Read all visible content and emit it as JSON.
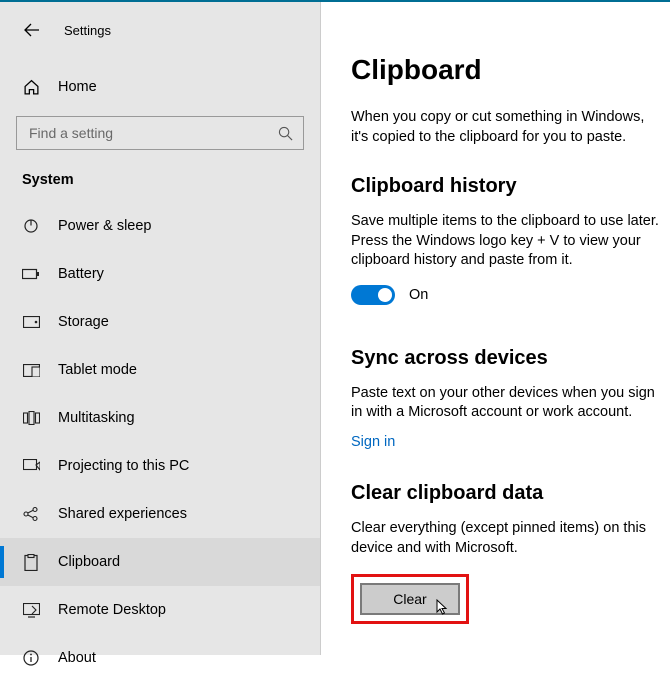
{
  "window": {
    "title": "Settings"
  },
  "sidebar": {
    "home_label": "Home",
    "search_placeholder": "Find a setting",
    "section_label": "System",
    "items": [
      {
        "label": "Power & sleep"
      },
      {
        "label": "Battery"
      },
      {
        "label": "Storage"
      },
      {
        "label": "Tablet mode"
      },
      {
        "label": "Multitasking"
      },
      {
        "label": "Projecting to this PC"
      },
      {
        "label": "Shared experiences"
      },
      {
        "label": "Clipboard"
      },
      {
        "label": "Remote Desktop"
      },
      {
        "label": "About"
      }
    ]
  },
  "main": {
    "title": "Clipboard",
    "intro": "When you copy or cut something in Windows, it's copied to the clipboard for you to paste.",
    "history_title": "Clipboard history",
    "history_text": "Save multiple items to the clipboard to use later. Press the Windows logo key + V to view your clipboard history and paste from it.",
    "toggle_label": "On",
    "sync_title": "Sync across devices",
    "sync_text": "Paste text on your other devices when you sign in with a Microsoft account or work account.",
    "sign_in": "Sign in",
    "clear_title": "Clear clipboard data",
    "clear_text": "Clear everything (except pinned items) on this device and with Microsoft.",
    "clear_button": "Clear"
  }
}
